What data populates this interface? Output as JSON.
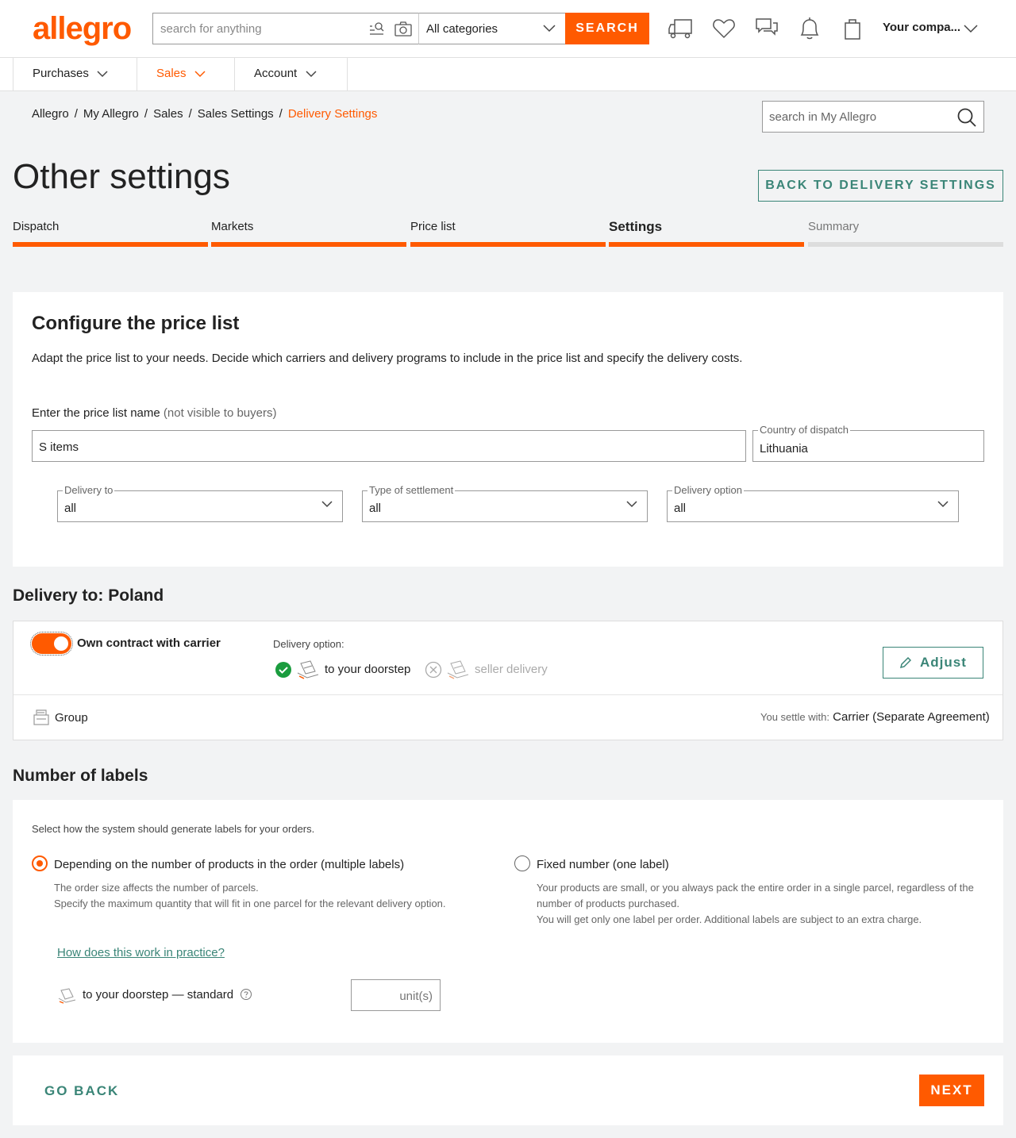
{
  "header": {
    "logo": "allegro",
    "search_placeholder": "search for anything",
    "category": "All categories",
    "search_button": "SEARCH",
    "account": "Your compa..."
  },
  "nav": {
    "tabs": [
      {
        "label": "Purchases"
      },
      {
        "label": "Sales"
      },
      {
        "label": "Account"
      }
    ]
  },
  "breadcrumb": [
    "Allegro",
    "My Allegro",
    "Sales",
    "Sales Settings",
    "Delivery Settings"
  ],
  "breadcrumb_sep": "/",
  "my_search_placeholder": "search in My Allegro",
  "page": {
    "title": "Other settings",
    "back_button": "BACK TO DELIVERY SETTINGS"
  },
  "steps": [
    {
      "label": "Dispatch",
      "state": "done"
    },
    {
      "label": "Markets",
      "state": "done"
    },
    {
      "label": "Price list",
      "state": "done"
    },
    {
      "label": "Settings",
      "state": "active"
    },
    {
      "label": "Summary",
      "state": "pending"
    }
  ],
  "config": {
    "title": "Configure the price list",
    "description": "Adapt the price list to your needs. Decide which carriers and delivery programs to include in the price list and specify the delivery costs.",
    "name_label": "Enter the price list name",
    "name_hint": "(not visible to buyers)",
    "name_value": "S items",
    "country_label": "Country of dispatch",
    "country_value": "Lithuania",
    "delivery_to_label": "Delivery to",
    "delivery_to_value": "all",
    "settlement_label": "Type of settlement",
    "settlement_value": "all",
    "delivery_option_label": "Delivery option",
    "delivery_option_value": "all"
  },
  "poland": {
    "title": "Delivery to: Poland",
    "own_contract": "Own contract with carrier",
    "toggle_on": true,
    "delivery_option_label": "Delivery option:",
    "option1": "to your doorstep",
    "option2": "seller delivery",
    "adjust_button": "Adjust",
    "group_label": "Group",
    "settle_label": "You settle with:",
    "settle_value": "Carrier (Separate Agreement)"
  },
  "labels": {
    "title": "Number of labels",
    "intro": "Select how the system should generate labels for your orders.",
    "option_multi": {
      "title": "Depending on the number of products in the order (multiple labels)",
      "desc1": "The order size affects the number of parcels.",
      "desc2": "Specify the maximum quantity that will fit in one parcel for the relevant delivery option."
    },
    "option_single": {
      "title": "Fixed number (one label)",
      "desc1": "Your products are small, or you always pack the entire order in a single parcel, regardless of the",
      "desc2": "number of products purchased.",
      "desc3": "You will get only one label per order. Additional labels are subject to an extra charge."
    },
    "how_link": "How does this work in practice?",
    "doorstep_standard": "to your doorstep — standard",
    "units_placeholder": "unit(s)"
  },
  "footer": {
    "go_back": "GO BACK",
    "next": "NEXT"
  },
  "colors": {
    "brand": "#ff5a00",
    "accent_green": "#3a8577",
    "background": "#f2f3f4"
  }
}
